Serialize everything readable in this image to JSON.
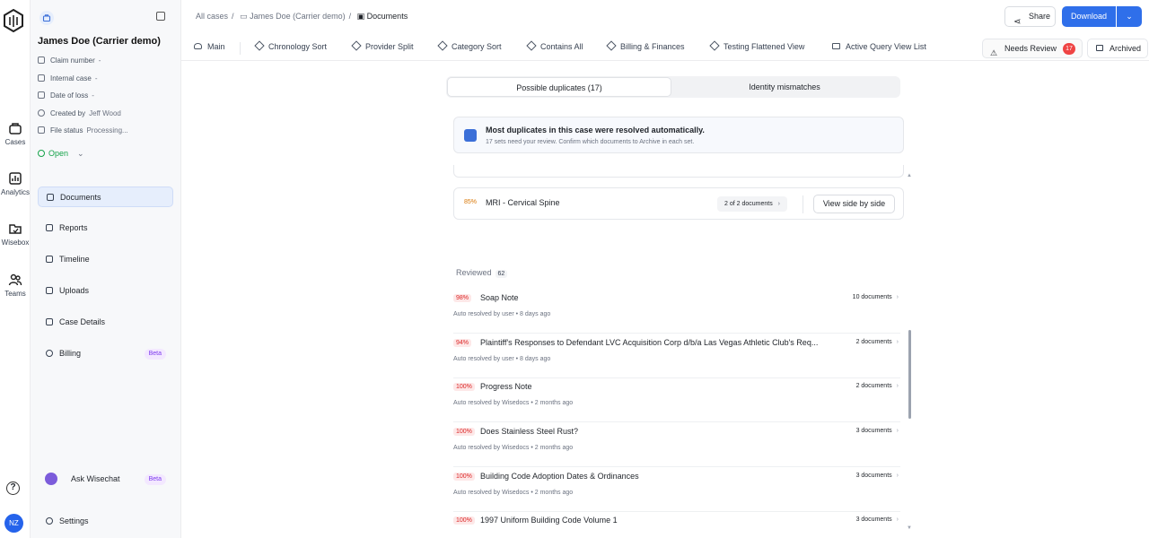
{
  "rail": {
    "items": [
      {
        "label": "Cases",
        "icon": "cases-icon"
      },
      {
        "label": "Analytics",
        "icon": "analytics-icon"
      },
      {
        "label": "Wisebox",
        "icon": "wisebox-icon"
      },
      {
        "label": "Teams",
        "icon": "teams-icon"
      }
    ],
    "help": "?",
    "avatar": "NZ"
  },
  "sidebar": {
    "case_name": "James Doe (Carrier demo)",
    "meta": [
      {
        "label": "Claim number",
        "value": "-"
      },
      {
        "label": "Internal case",
        "value": "-"
      },
      {
        "label": "Date of loss",
        "value": "-"
      },
      {
        "label": "Created by",
        "value": "Jeff Wood"
      },
      {
        "label": "File status",
        "value": "Processing..."
      }
    ],
    "status": "Open",
    "nav": [
      {
        "label": "Documents"
      },
      {
        "label": "Reports"
      },
      {
        "label": "Timeline"
      },
      {
        "label": "Uploads"
      },
      {
        "label": "Case Details"
      },
      {
        "label": "Billing",
        "badge": "Beta"
      }
    ],
    "ask": {
      "label": "Ask Wisechat",
      "badge": "Beta"
    },
    "settings": "Settings"
  },
  "topbar": {
    "crumbs": [
      "All cases",
      "James Doe (Carrier demo)",
      "Documents"
    ],
    "share": "Share",
    "download": "Download"
  },
  "tabs": {
    "items": [
      "Main",
      "Chronology Sort",
      "Provider Split",
      "Category Sort",
      "Contains All",
      "Billing & Finances",
      "Testing Flattened View",
      "Active Query View List"
    ],
    "needs_review": "Needs Review",
    "needs_review_count": "17",
    "archived": "Archived"
  },
  "segment": {
    "active": "Possible duplicates (17)",
    "inactive": "Identity mismatches"
  },
  "banner": {
    "title": "Most duplicates in this case were resolved automatically.",
    "subtitle": "17 sets need your review. Confirm which documents to Archive in each set."
  },
  "pending": {
    "pct": "85%",
    "name": "MRI - Cervical Spine",
    "count": "2 of 2 documents",
    "action": "View side by side"
  },
  "reviewed": {
    "label": "Reviewed",
    "count": "62",
    "rows": [
      {
        "pct": "98%",
        "title": "Soap Note",
        "sub": "Auto resolved by user  •  8 days ago",
        "docs": "10 documents"
      },
      {
        "pct": "94%",
        "title": "Plaintiff's Responses to Defendant LVC Acquisition Corp d/b/a Las Vegas Athletic Club's Req...",
        "sub": "Auto resolved by user  •  8 days ago",
        "docs": "2 documents"
      },
      {
        "pct": "100%",
        "title": "Progress Note",
        "sub": "Auto resolved by Wisedocs  •  2 months ago",
        "docs": "2 documents"
      },
      {
        "pct": "100%",
        "title": "Does Stainless Steel Rust?",
        "sub": "Auto resolved by Wisedocs  •  2 months ago",
        "docs": "3 documents"
      },
      {
        "pct": "100%",
        "title": "Building Code Adoption Dates & Ordinances",
        "sub": "Auto resolved by Wisedocs  •  2 months ago",
        "docs": "3 documents"
      },
      {
        "pct": "100%",
        "title": "1997 Uniform Building Code Volume 1",
        "sub": "",
        "docs": "3 documents"
      }
    ]
  }
}
